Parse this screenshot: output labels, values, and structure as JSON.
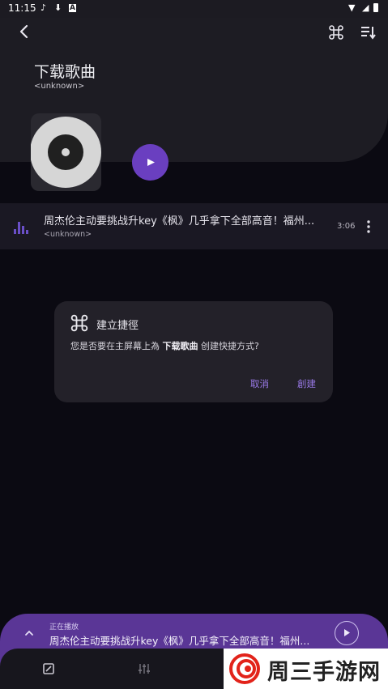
{
  "status_bar": {
    "time": "11:15"
  },
  "header": {
    "title": "下载歌曲",
    "subtitle": "<unknown>"
  },
  "song": {
    "title": "周杰伦主动要挑战升key《枫》几乎拿下全部高音！福州...",
    "artist": "<unknown>",
    "duration": "3:06"
  },
  "dialog": {
    "title": "建立捷徑",
    "body_prefix": "您是否要在主屏幕上為 ",
    "body_bold": "下载歌曲",
    "body_suffix": " 创建快捷方式?",
    "cancel_label": "取消",
    "create_label": "創建"
  },
  "mini_player": {
    "label": "正在播放",
    "title": "周杰伦主动要挑战升key《枫》几乎拿下全部高音！福州..."
  },
  "watermark": {
    "text": "周三手游网"
  },
  "colors": {
    "accent": "#6a3fc0",
    "dialog_button": "#9a7ae8",
    "mini_player_bg": "#5a3696",
    "background": "#0b0a12"
  }
}
